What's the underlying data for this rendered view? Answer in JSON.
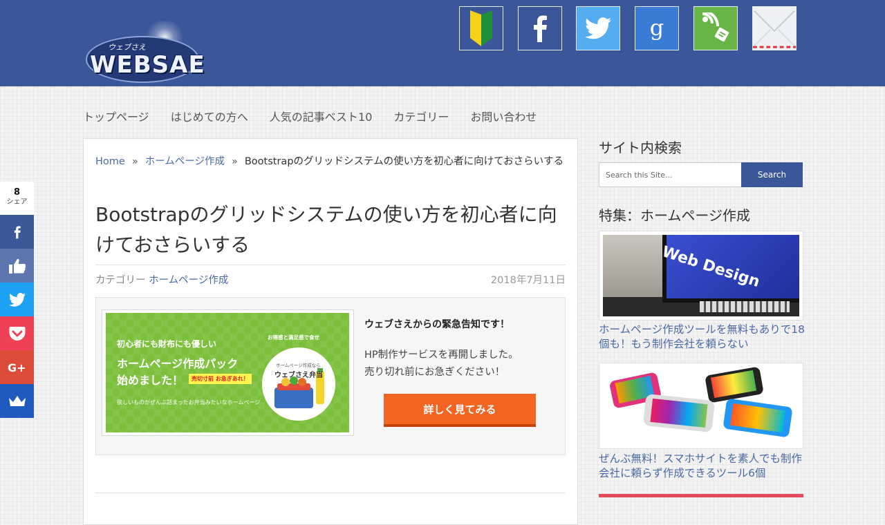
{
  "header": {
    "logo_kana": "ウェブさえ",
    "logo_text": "WEBSAE",
    "social_icons": [
      "beginner-mark-icon",
      "facebook-icon",
      "twitter-icon",
      "google-plus-icon",
      "feedly-rss-icon",
      "mail-icon"
    ],
    "brand_color": "#3b5699"
  },
  "nav": {
    "items": [
      "トップページ",
      "はじめての方へ",
      "人気の記事ベスト10",
      "カテゴリー",
      "お問い合わせ"
    ]
  },
  "share_bar": {
    "count": "8",
    "count_label": "シェア",
    "buttons": [
      {
        "icon": "facebook-icon",
        "color": "#3b5999"
      },
      {
        "icon": "like-icon",
        "color": "#5d76b0"
      },
      {
        "icon": "twitter-icon",
        "color": "#1da1f2"
      },
      {
        "icon": "pocket-icon",
        "color": "#ef4056"
      },
      {
        "icon": "google-plus-icon",
        "color": "#dd4b39"
      },
      {
        "icon": "crown-icon",
        "color": "#1f5bbf"
      }
    ]
  },
  "breadcrumb": {
    "home": "Home",
    "category": "ホームページ作成",
    "current": "Bootstrapのグリッドシステムの使い方を初心者に向けておさらいする"
  },
  "article": {
    "title": "Bootstrapのグリッドシステムの使い方を初心者に向けておさらいする",
    "category_label": "カテゴリー",
    "category": "ホームページ作成",
    "date": "2018年7月11日"
  },
  "notice": {
    "banner": {
      "line1": "初心者にも財布にも優しい",
      "line2": "ホームページ作成パック",
      "line3": "始めました！",
      "badge": "売切寸前 お急ぎあれ！",
      "footer": "欲しいものがぜんぶ詰まったお弁当みたいなホームページ",
      "arc": "お得感と満足感で食せ",
      "circle_small": "ホームページ作成なら",
      "circle_main": "ウェブさえ弁当"
    },
    "title": "ウェブさえからの緊急告知です！",
    "body_line1": "HP制作サービスを再開しました。",
    "body_line2": "売り切れ前にお急ぎください！",
    "cta": "詳しく見てみる"
  },
  "sidebar": {
    "search_heading": "サイト内検索",
    "search_placeholder": "Search this Site...",
    "search_button": "Search",
    "feature_heading": "特集：ホームページ作成",
    "cards": [
      {
        "image_text": "Web Design",
        "title": "ホームページ作成ツールを無料もありで18個も！もう制作会社を頼らない"
      },
      {
        "title": "ぜんぶ無料！スマホサイトを素人でも制作会社に頼らず作成できるツール6個"
      }
    ]
  }
}
